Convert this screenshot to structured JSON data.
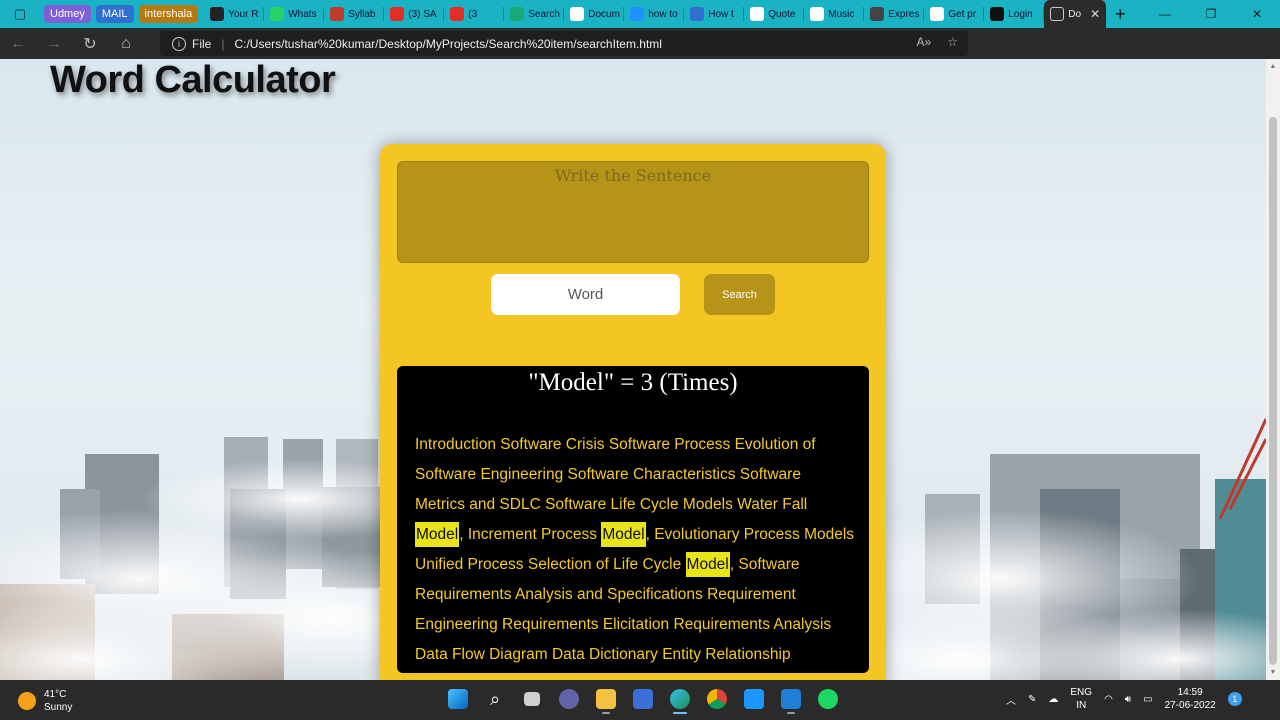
{
  "browser": {
    "pinned_tabs": [
      {
        "label": "Udmey",
        "color": "#7e5fd6"
      },
      {
        "label": "MAIL",
        "color": "#2f6fd0"
      },
      {
        "label": "intershala",
        "color": "#b7780d"
      }
    ],
    "tabs": [
      {
        "label": "Your R",
        "icon_color": "#222222"
      },
      {
        "label": "Whats",
        "icon_color": "#25d366"
      },
      {
        "label": "Syllab",
        "icon_color": "#c0392b"
      },
      {
        "label": "(3) SA",
        "icon_color": "#e52d27"
      },
      {
        "label": "(3",
        "icon_color": "#e52d27"
      },
      {
        "label": "Search",
        "icon_color": "#1aa879"
      },
      {
        "label": "Docum",
        "icon_color": "#ffffff"
      },
      {
        "label": "how to",
        "icon_color": "#1e90ff"
      },
      {
        "label": "How t",
        "icon_color": "#2f6fd0"
      },
      {
        "label": "Quote",
        "icon_color": "#ffffff"
      },
      {
        "label": "Music",
        "icon_color": "#ffffff"
      },
      {
        "label": "Expres",
        "icon_color": "#444444"
      },
      {
        "label": "Get pr",
        "icon_color": "#ffffff"
      },
      {
        "label": "Login",
        "icon_color": "#111111"
      }
    ],
    "active_tab": {
      "label": "Do",
      "close_symbol": "✕"
    },
    "new_tab_symbol": "+",
    "window_controls": [
      "—",
      "❐",
      "✕"
    ],
    "address": {
      "protocol_label": "File",
      "url": "C:/Users/tushar%20kumar/Desktop/MyProjects/Search%20item/searchItem.html"
    }
  },
  "page": {
    "title": "Word Calculator",
    "sentence_placeholder": "Write the Sentence",
    "word_placeholder": "Word",
    "search_label": "Search",
    "result_heading": "\"Model\" = 3 (Times)",
    "result_segments": [
      {
        "text": "Introduction Software Crisis Software Process Evolution of Software Engineering Software Characteristics Software Metrics and SDLC Software Life Cycle Models Water Fall ",
        "highlight": false
      },
      {
        "text": "Model",
        "highlight": true
      },
      {
        "text": ", Increment Process ",
        "highlight": false
      },
      {
        "text": "Model",
        "highlight": true
      },
      {
        "text": ", Evolutionary Process Models Unified Process Selection of Life Cycle ",
        "highlight": false
      },
      {
        "text": "Model",
        "highlight": true
      },
      {
        "text": ", Software Requirements Analysis and Specifications Requirement Engineering Requirements Elicitation Requirements Analysis Data Flow Diagram Data Dictionary Entity Relationship Diagrams Decision",
        "highlight": false
      }
    ],
    "colors": {
      "card": "#f3c623",
      "input_box": "#b59417",
      "result_bg": "#000000",
      "result_text": "#f4ca2a",
      "highlight": "#e9e41a"
    }
  },
  "taskbar": {
    "weather_temp": "41°C",
    "weather_desc": "Sunny",
    "lang_line1": "ENG",
    "lang_line2": "IN",
    "time": "14:59",
    "date": "27-06-2022",
    "notification_count": "1"
  }
}
